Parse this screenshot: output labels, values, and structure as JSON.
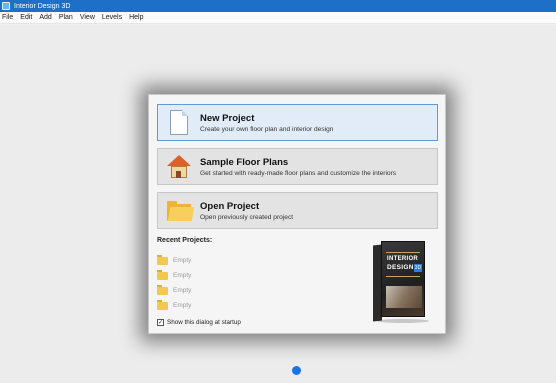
{
  "window": {
    "title": "Interior Design 3D",
    "icon": "app-icon"
  },
  "menu": [
    "File",
    "Edit",
    "Add",
    "Plan",
    "View",
    "Levels",
    "Help"
  ],
  "dialog": {
    "options": [
      {
        "title": "New Project",
        "desc": "Create your own floor plan and interior design",
        "icon": "new-document-icon",
        "selected": true
      },
      {
        "title": "Sample Floor Plans",
        "desc": "Get started with ready-made floor plans and customize the interiors",
        "icon": "house-icon",
        "selected": false
      },
      {
        "title": "Open Project",
        "desc": "Open previously created project",
        "icon": "folder-icon",
        "selected": false
      }
    ],
    "recent_heading": "Recent Projects:",
    "recent_items": [
      "Empty",
      "Empty",
      "Empty",
      "Empty"
    ],
    "show_on_startup_label": "Show this dialog at startup",
    "show_on_startup_checked": true,
    "product_box": {
      "line1": "INTERIOR",
      "line2": "DESIGN",
      "badge": "3D"
    }
  },
  "colors": {
    "titlebar": "#1d6fc8",
    "selected_border": "#5f9ad8",
    "status_dot": "#1a73e8"
  }
}
